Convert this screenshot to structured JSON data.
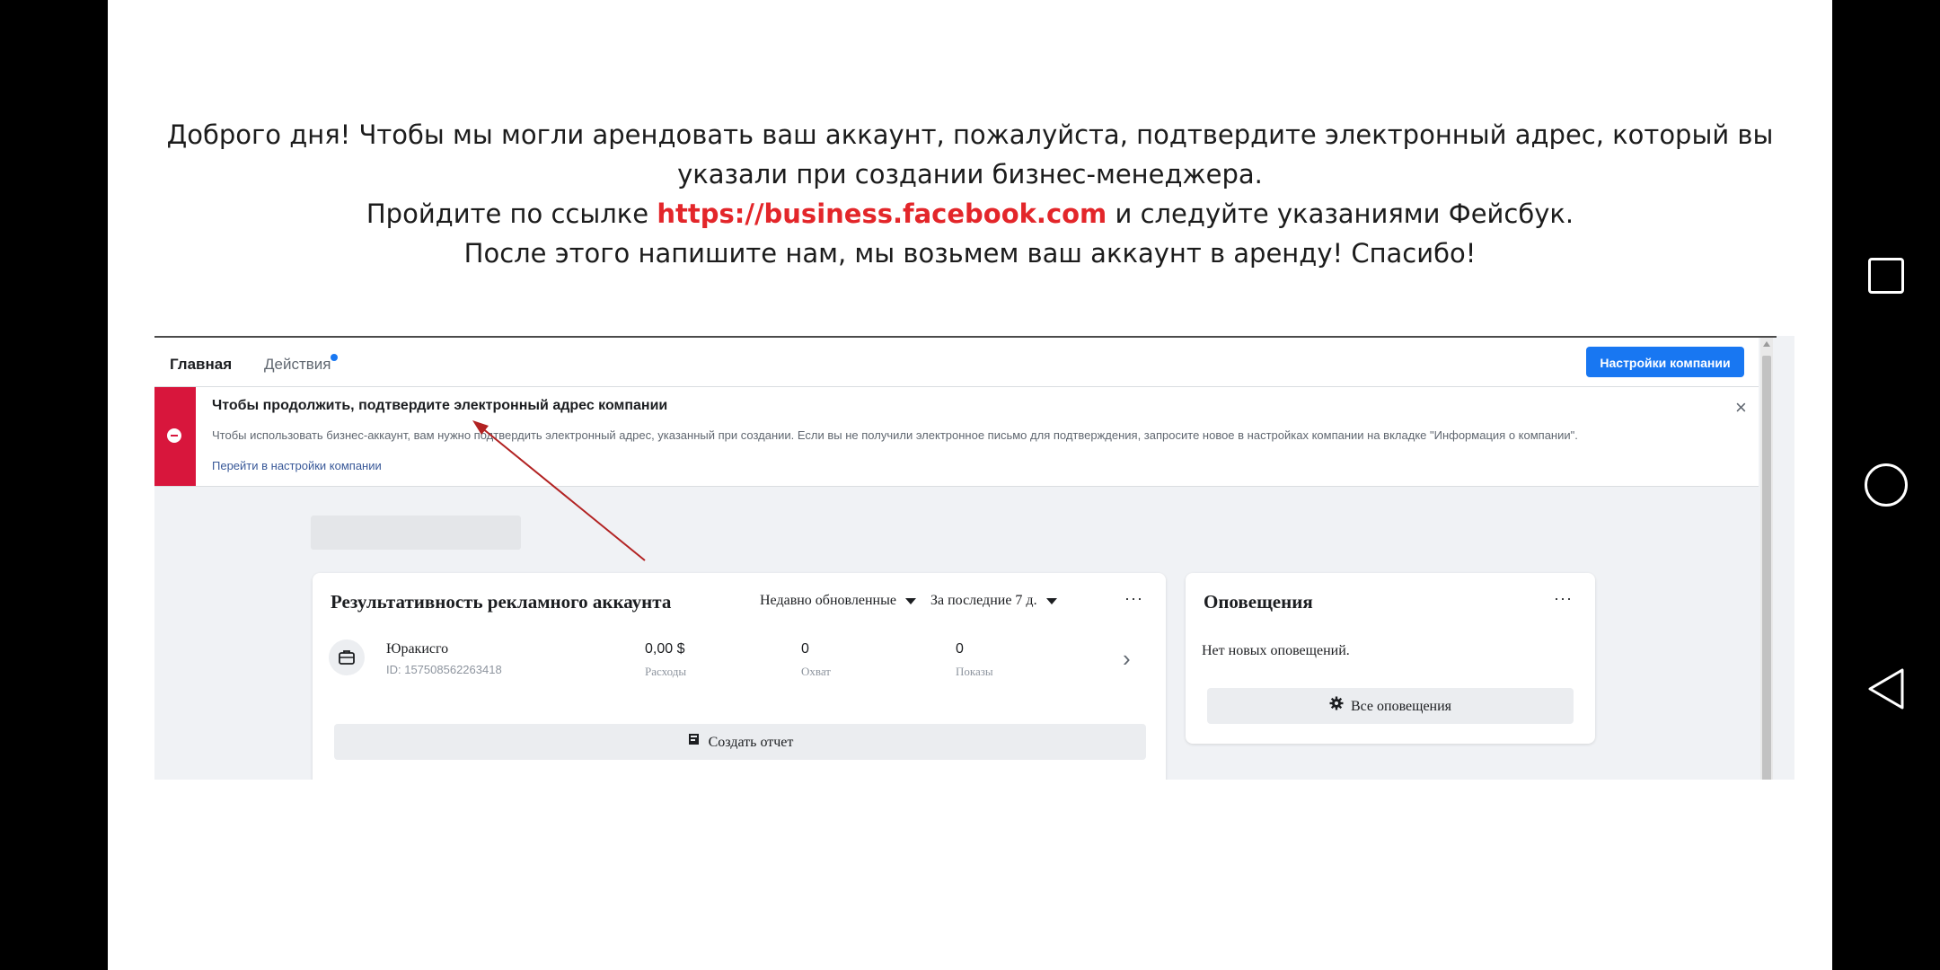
{
  "instructions": {
    "line1": "Доброго дня! Чтобы мы могли арендовать ваш аккаунт, пожалуйста, подтвердите электронный адрес, который вы",
    "line2": "указали при создании бизнес-менеджера.",
    "line3_before": "Пройдите по ссылке ",
    "line3_link": "https://business.facebook.com",
    "line3_after": " и следуйте указаниями Фейсбук.",
    "line4": "После этого напишите нам, мы возьмем ваш аккаунт в аренду! Спасибо!"
  },
  "nav": {
    "tabs": [
      {
        "label": "Главная"
      },
      {
        "label": "Действия"
      }
    ],
    "company_settings_button": "Настройки компании"
  },
  "alert": {
    "title": "Чтобы продолжить, подтвердите электронный адрес компании",
    "text": "Чтобы использовать бизнес-аккаунт, вам нужно подтвердить электронный адрес, указанный при создании. Если вы не получили электронное письмо для подтверждения, запросите новое в настройках компании на вкладке \"Информация о компании\".",
    "link": "Перейти в настройки компании",
    "close": "×"
  },
  "performance": {
    "title": "Результативность рекламного аккаунта",
    "filter_sort": "Недавно обновленные",
    "filter_period": "За последние 7 д.",
    "menu": "···",
    "account": {
      "name": "Юракисго",
      "id": "ID: 157508562263418",
      "spend_value": "0,00 $",
      "spend_label": "Расходы",
      "reach_value": "0",
      "reach_label": "Охват",
      "impressions_value": "0",
      "impressions_label": "Показы"
    },
    "create_report_button": "Создать отчет"
  },
  "notifications": {
    "title": "Оповещения",
    "menu": "···",
    "empty_text": "Нет новых оповещений.",
    "all_button": "Все оповещения"
  },
  "colors": {
    "link_red": "#e3262a",
    "fb_blue": "#1877f2",
    "alert_red": "#d8163c",
    "arrow": "#b22222"
  },
  "icons": [
    "briefcase-icon",
    "report-icon",
    "gear-icon",
    "close-icon",
    "chevron-right-icon",
    "caret-down-icon",
    "error-icon"
  ]
}
